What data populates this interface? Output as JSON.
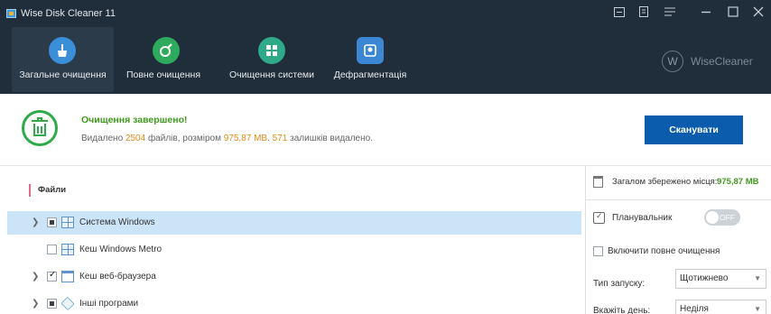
{
  "window": {
    "title": "Wise Disk Cleaner 11",
    "controls": [
      "menu-icon",
      "feedback-icon",
      "settings-icon",
      "minimize-icon",
      "maximize-icon",
      "close-icon"
    ]
  },
  "nav": {
    "tabs": [
      {
        "label": "Загальне очищення",
        "icon": "broom-icon",
        "color": "#3b8ed8",
        "active": true
      },
      {
        "label": "Повне очищення",
        "icon": "deep-clean-icon",
        "color": "#2eaa5c",
        "active": false
      },
      {
        "label": "Очищення системи",
        "icon": "windows-icon",
        "color": "#2eaa88",
        "active": false
      },
      {
        "label": "Дефрагментація",
        "icon": "disk-icon",
        "color": "#3c86d4",
        "active": false
      }
    ]
  },
  "brand": {
    "logo": "W",
    "name": "WiseCleaner"
  },
  "status": {
    "title": "Очищення завершено!",
    "prefix": "Видалено",
    "files_count": "2504",
    "files_text": "файлів, розміром",
    "size": "975,87 MB",
    "sep": ".",
    "items_count": "571",
    "items_text": "залишків видалено."
  },
  "scan_button": "Сканувати",
  "files": {
    "header": "Файли",
    "items": [
      {
        "label": "Система Windows",
        "state": "partial",
        "expandable": true,
        "icon": "windows-grid-icon",
        "selected": true
      },
      {
        "label": "Кеш Windows Metro",
        "state": "unchecked",
        "expandable": false,
        "icon": "metro-grid-icon",
        "selected": false
      },
      {
        "label": "Кеш веб-браузера",
        "state": "checked",
        "expandable": true,
        "icon": "browser-icon",
        "selected": false
      },
      {
        "label": "Інші програми",
        "state": "partial",
        "expandable": true,
        "icon": "package-icon",
        "selected": false
      }
    ]
  },
  "right": {
    "saved_label": "Загалом збережено місця:",
    "saved_value": "975,87 MB",
    "scheduler_label": "Планувальник",
    "scheduler_toggle": "OFF",
    "full_clean_label": "Включити повне очищення",
    "launch_type_label": "Тип запуску:",
    "launch_type_value": "Щотижнево",
    "day_label": "Вкажіть день:",
    "day_value": "Неділя"
  },
  "colors": {
    "header_bg": "#202d3a",
    "accent_blue": "#0c5cae",
    "success_green": "#3f9a1c",
    "highlight_orange": "#e08a1c",
    "selection": "#cce4f7"
  }
}
